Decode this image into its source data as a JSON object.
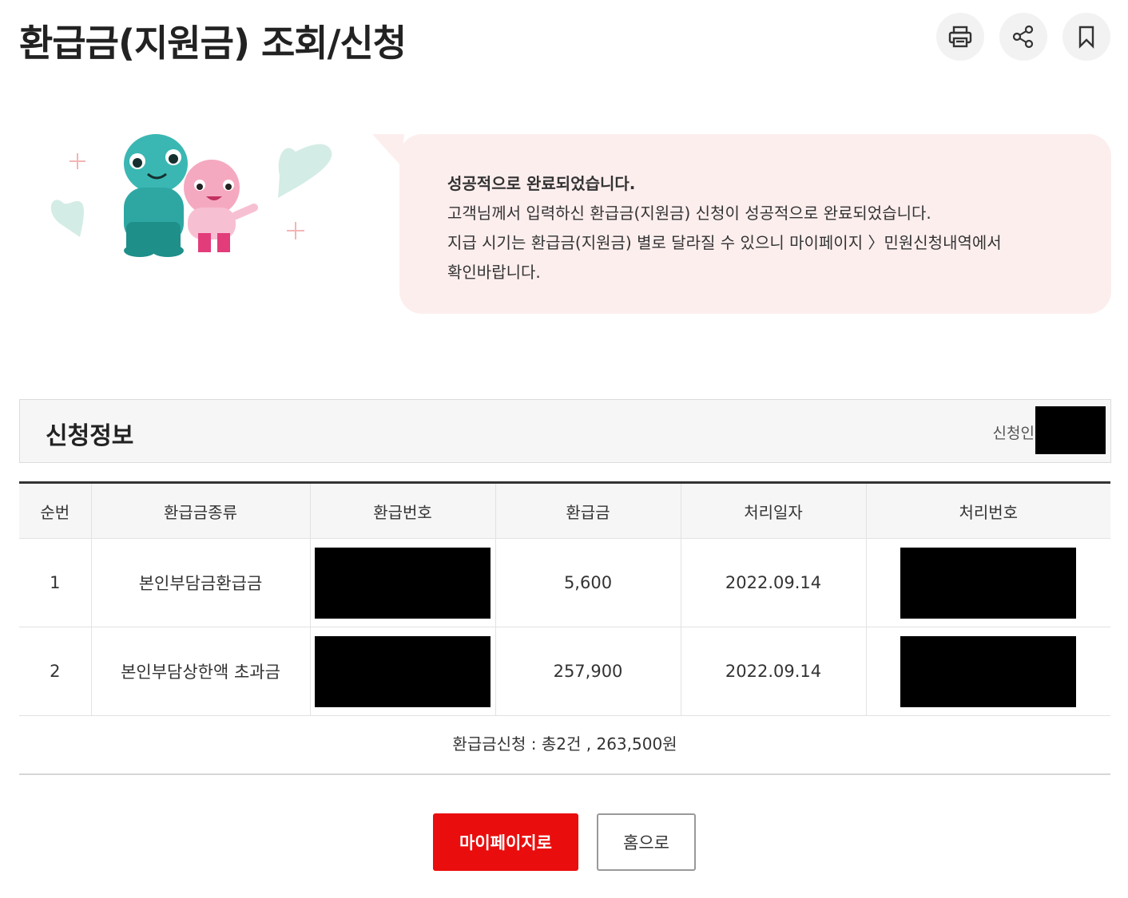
{
  "header": {
    "title": "환급금(지원금) 조회/신청",
    "print_icon": "printer-icon",
    "share_icon": "share-icon",
    "bookmark_icon": "bookmark-icon"
  },
  "message": {
    "title": "성공적으로 완료되었습니다.",
    "line1": "고객님께서 입력하신 환급금(지원금) 신청이 성공적으로 완료되었습니다.",
    "line2": "지급 시기는 환급금(지원금) 별로 달라질 수 있으니 마이페이지 〉민원신청내역에서",
    "line3": "확인바랍니다."
  },
  "info": {
    "title": "신청정보",
    "applicant_label": "신청인"
  },
  "table": {
    "headers": [
      "순번",
      "환급금종류",
      "환급번호",
      "환급금",
      "처리일자",
      "처리번호"
    ],
    "rows": [
      {
        "no": "1",
        "type": "본인부담금환급금",
        "amount": "5,600",
        "date": "2022.09.14"
      },
      {
        "no": "2",
        "type": "본인부담상한액 초과금",
        "amount": "257,900",
        "date": "2022.09.14"
      }
    ]
  },
  "summary": "환급금신청 : 총2건 , 263,500원",
  "buttons": {
    "mypage": "마이페이지로",
    "home": "홈으로"
  },
  "colors": {
    "accent": "#ea0d0d",
    "message_bg": "#fdeeee"
  }
}
